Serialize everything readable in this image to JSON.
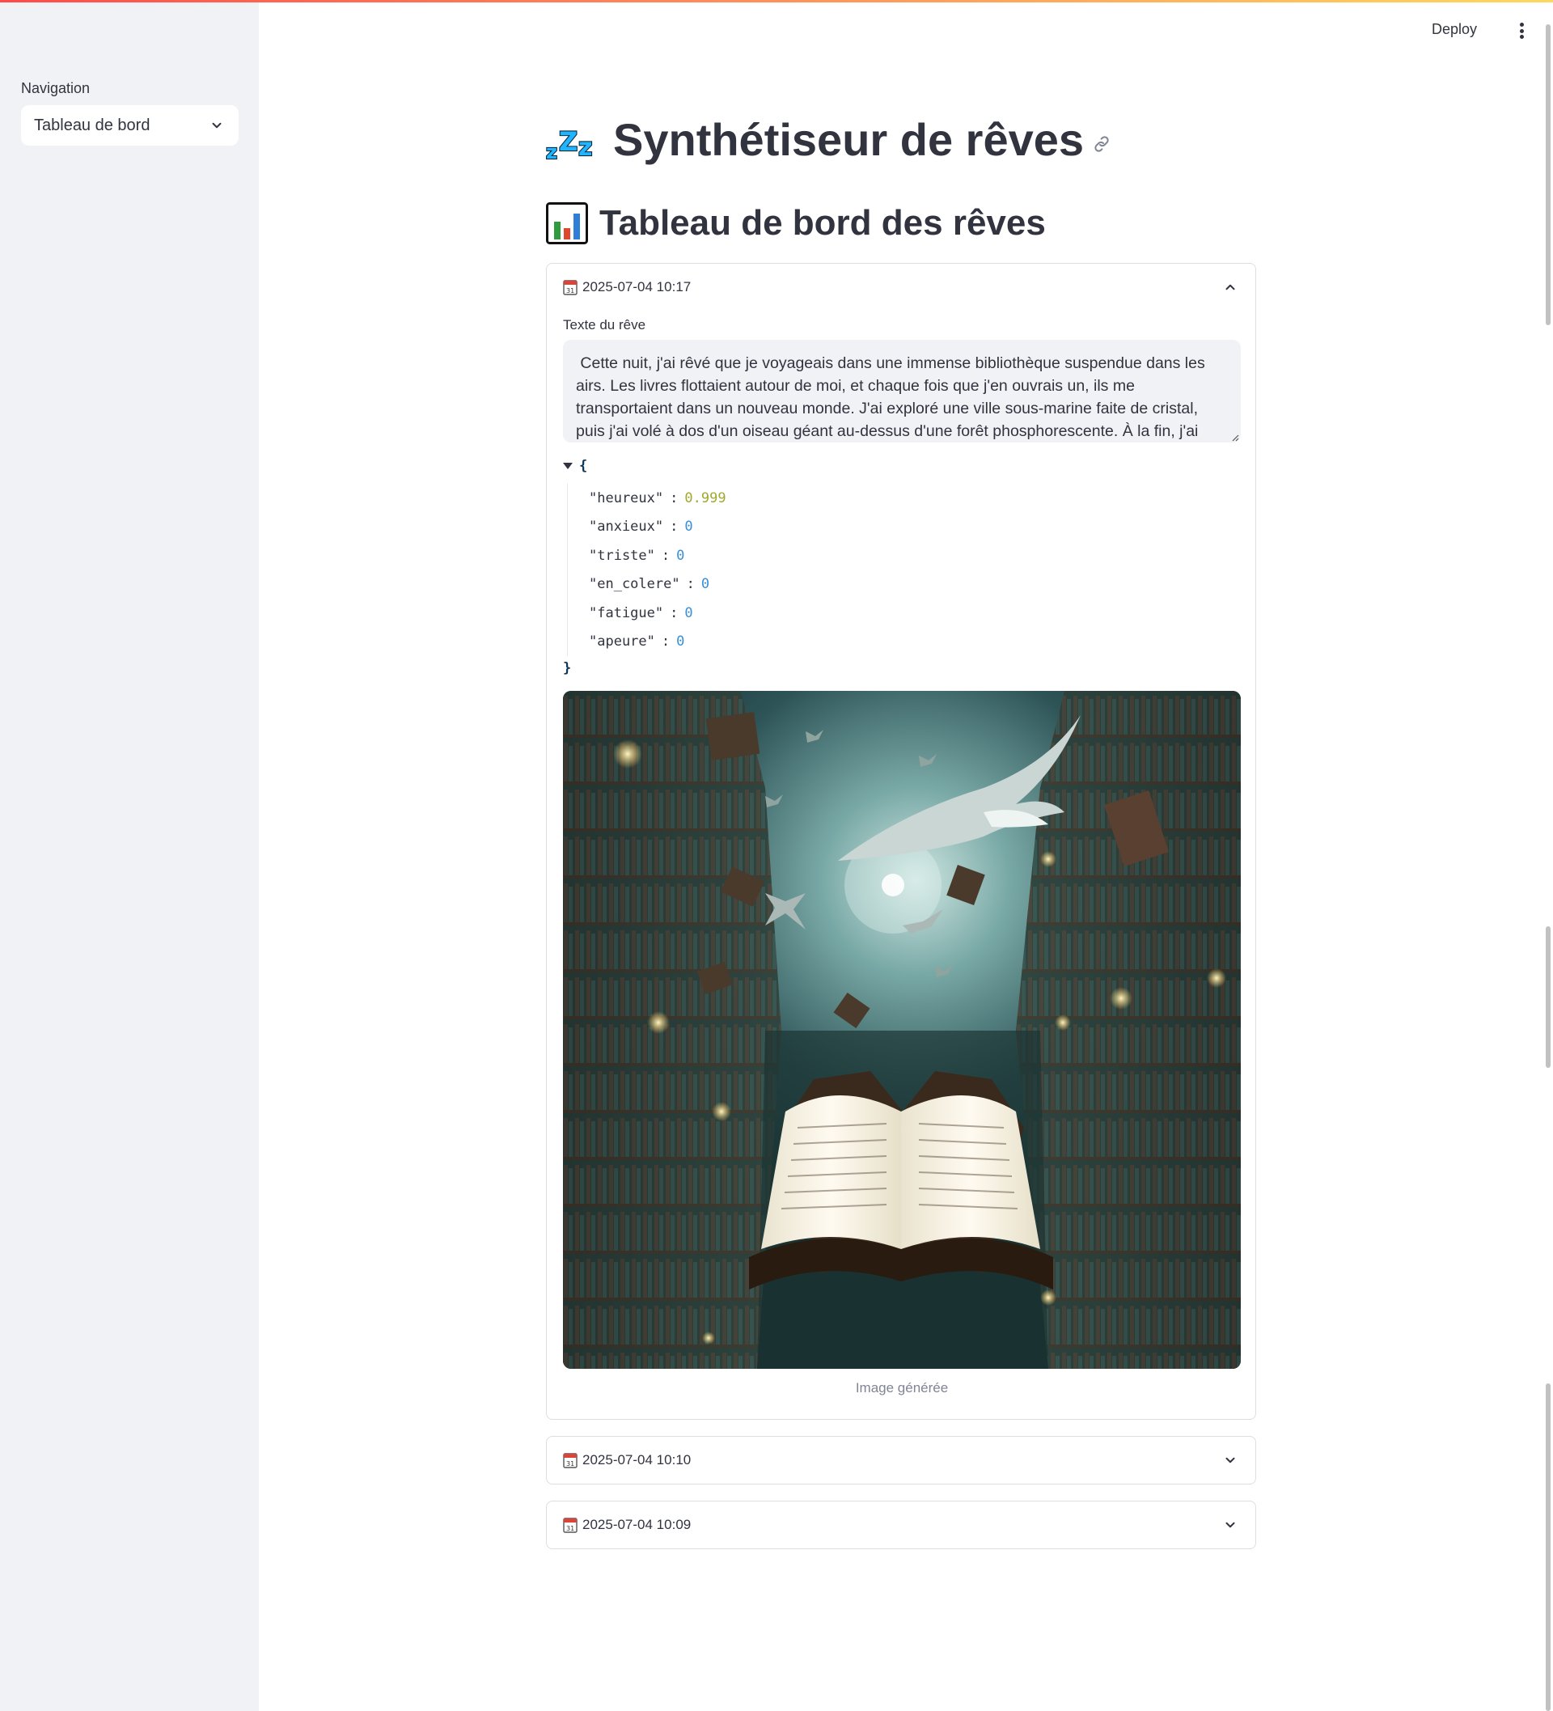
{
  "sidebar": {
    "nav_label": "Navigation",
    "nav_selected": "Tableau de bord"
  },
  "header": {
    "deploy_label": "Deploy"
  },
  "page": {
    "title": "Synthétiseur de rêves",
    "subtitle": "Tableau de bord des rêves"
  },
  "entries": [
    {
      "date": "2025-07-04 10:17",
      "expanded": true,
      "text_label": "Texte du rêve",
      "text": " Cette nuit, j'ai rêvé que je voyageais dans une immense bibliothèque suspendue dans les airs. Les livres flottaient autour de moi, et chaque fois que j'en ouvrais un, ils me transportaient dans un nouveau monde. J'ai exploré une ville sous-marine faite de cristal, puis j'ai volé à dos d'un oiseau géant au-dessus d'une forêt phosphorescente. À la fin, j'ai trouvé un livre où les pages",
      "emotions": [
        {
          "key": "\"heureux\"",
          "value": "0.999"
        },
        {
          "key": "\"anxieux\"",
          "value": "0"
        },
        {
          "key": "\"triste\"",
          "value": "0"
        },
        {
          "key": "\"en_colere\"",
          "value": "0"
        },
        {
          "key": "\"fatigue\"",
          "value": "0"
        },
        {
          "key": "\"apeure\"",
          "value": "0"
        }
      ],
      "image_caption": "Image générée"
    },
    {
      "date": "2025-07-04 10:10",
      "expanded": false
    },
    {
      "date": "2025-07-04 10:09",
      "expanded": false
    }
  ],
  "json_open": "{",
  "json_close": "}",
  "colors": {
    "sidebar_bg": "#f0f2f6",
    "text": "#31333f",
    "json_float": "#a2a830",
    "json_int": "#3a8fd6",
    "caption": "#808495"
  },
  "icons": [
    "zzz-icon",
    "link-icon",
    "bar-chart-icon",
    "calendar-icon",
    "chevron-up-icon",
    "chevron-down-icon",
    "kebab-menu-icon"
  ]
}
